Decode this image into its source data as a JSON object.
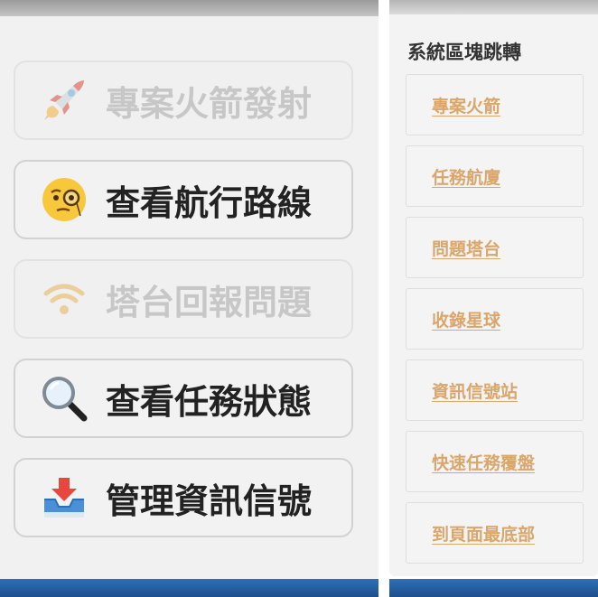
{
  "left_panel": {
    "buttons": [
      {
        "label": "專案火箭發射",
        "icon": "rocket-icon",
        "enabled": false
      },
      {
        "label": "查看航行路線",
        "icon": "monocle-face-icon",
        "enabled": true
      },
      {
        "label": "塔台回報問題",
        "icon": "wifi-icon",
        "enabled": false
      },
      {
        "label": "查看任務狀態",
        "icon": "magnifier-icon",
        "enabled": true
      },
      {
        "label": "管理資訊信號",
        "icon": "inbox-tray-icon",
        "enabled": true
      }
    ]
  },
  "right_panel": {
    "title": "系統區塊跳轉",
    "links": [
      {
        "label": "專案火箭"
      },
      {
        "label": "任務航廈"
      },
      {
        "label": "問題塔台"
      },
      {
        "label": "收錄星球"
      },
      {
        "label": "資訊信號站"
      },
      {
        "label": "快速任務覆盤"
      },
      {
        "label": "到頁面最底部"
      }
    ]
  },
  "colors": {
    "link_text": "#d9a66b",
    "label_text": "#222222",
    "disabled_text": "#c7c7c7",
    "bottom_bar": "#2f6fb6"
  }
}
